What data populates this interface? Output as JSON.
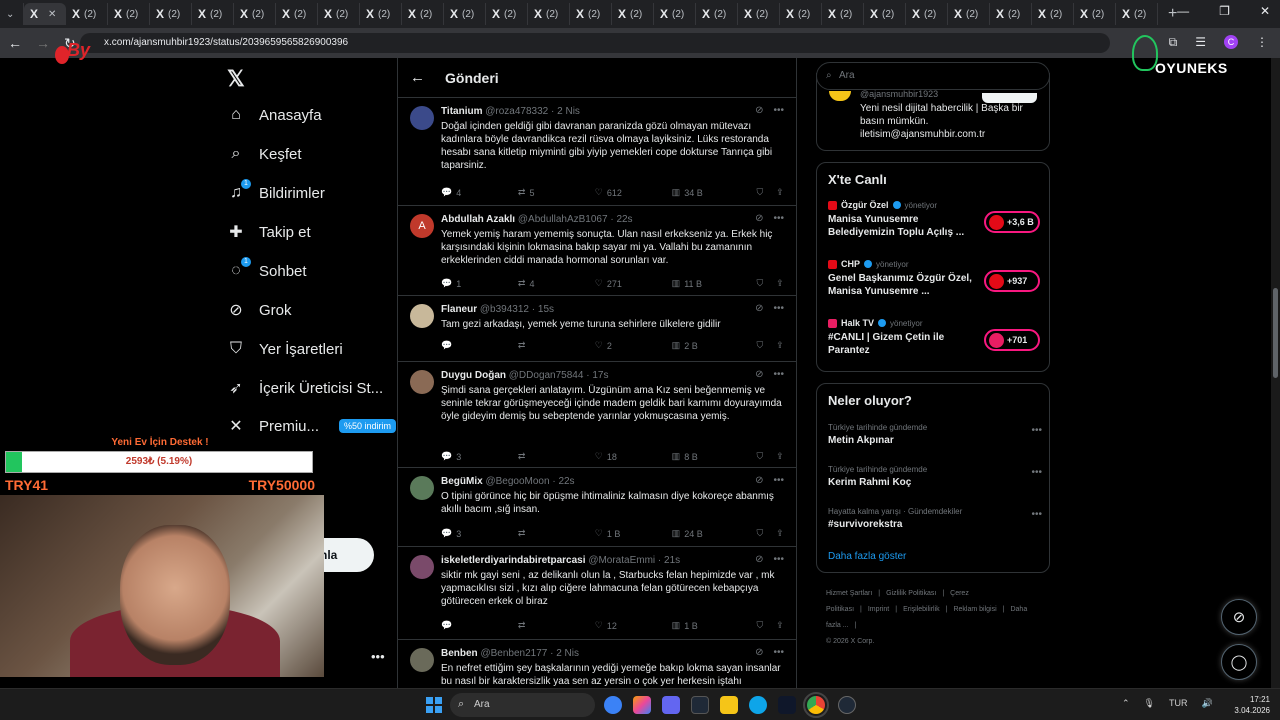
{
  "browser": {
    "active_tab_label": "X",
    "tab_label": "(2)",
    "tab_count": 26,
    "url": "x.com/ajansmuhbir1923/status/2039659565826900396",
    "profile_initial": "C"
  },
  "nav": {
    "items": [
      {
        "label": "Anasayfa",
        "icon": "home-icon"
      },
      {
        "label": "Keşfet",
        "icon": "search-icon"
      },
      {
        "label": "Bildirimler",
        "icon": "bell-icon",
        "dot": "1"
      },
      {
        "label": "Takip et",
        "icon": "add-person-icon"
      },
      {
        "label": "Sohbet",
        "icon": "chat-icon",
        "dot": "1"
      },
      {
        "label": "Grok",
        "icon": "grok-icon"
      },
      {
        "label": "Yer İşaretleri",
        "icon": "bookmark-icon"
      },
      {
        "label": "İçerik Üreticisi St...",
        "icon": "rocket-icon"
      },
      {
        "label": "Premiu...",
        "icon": "x-icon",
        "badge": "%50 indirim"
      }
    ],
    "post_button_partial": "nla"
  },
  "main": {
    "header_title": "Gönderi",
    "tweets": [
      {
        "name": "Titanium",
        "handle": "@roza478332",
        "time": "2 Nis",
        "text": "Doğal içinden geldiği gibi davranan paranizda gözü olmayan mütevazı kadınlara böyle davrandikca rezil rüsva olmaya layiksiniz. Lüks restoranda hesabı sana kitletip miyminti gibi yiyip yemekleri cope dokturse Tanrıça gibi taparsiniz.",
        "replies": "4",
        "reposts": "5",
        "likes": "612",
        "views": "34 B",
        "avatar_color": "#3b4a8a"
      },
      {
        "name": "Abdullah Azaklı",
        "handle": "@AbdullahAzB1067",
        "time": "22s",
        "text": "Yemek yemiş haram yememiş sonuçta. Ulan nasıl erkekseniz ya. Erkek hiç karşısındaki kişinin lokmasina bakıp sayar mi ya. Vallahi bu zamanının erkeklerinden ciddi manada hormonal sorunları var.",
        "replies": "1",
        "reposts": "4",
        "likes": "271",
        "views": "11 B",
        "avatar_color": "#c0392b",
        "avatar_letter": "A"
      },
      {
        "name": "Flaneur",
        "handle": "@b394312",
        "time": "15s",
        "text": "Tam gezi arkadaşı, yemek yeme turuna sehirlere ülkelere gidilir",
        "replies": "",
        "reposts": "",
        "likes": "2",
        "views": "2 B",
        "avatar_color": "#c8b89a"
      },
      {
        "name": "Duygu Doğan",
        "handle": "@DDogan75844",
        "time": "17s",
        "text": "Şimdi sana gerçekleri anlatayım. Üzgünüm ama Kız seni beğenmemiş ve seninle tekrar görüşmeyeceği içinde madem geldik bari karnımı doyurayımda öyle gideyim demiş bu sebeptende yarınlar yokmuşcasına yemiş.",
        "replies": "3",
        "reposts": "",
        "likes": "18",
        "views": "8 B",
        "avatar_color": "#8a6a55"
      },
      {
        "name": "BegüMix",
        "handle": "@BegooMoon",
        "time": "22s",
        "text": "O tipini görünce hiç bir öpüşme ihtimaliniz kalmasın diye kokoreçe abanmış akıllı bacım ,sığ insan.",
        "replies": "3",
        "reposts": "",
        "likes": "1 B",
        "views": "24 B",
        "avatar_color": "#5a7a5a"
      },
      {
        "name": "iskeletlerdiyarindabiretparcasi",
        "handle": "@MorataEmmi",
        "time": "21s",
        "text": "siktir mk gayi seni , az delikanlı olun la , Starbucks felan hepimizde var , mk yapmacıklısı sizi , kızı alıp ciğere lahmacuna felan götürecen kebapçıya götürecen erkek ol biraz",
        "replies": "",
        "reposts": "",
        "likes": "12",
        "views": "1 B",
        "avatar_color": "#7a4a6a"
      },
      {
        "name": "Benben",
        "handle": "@Benben2177",
        "time": "2 Nis",
        "text": "En nefret ettiğim şey başkalarının yediği yemeğe bakıp lokma sayan insanlar bu nasıl bir karaktersizlik yaa sen az yersin o çok yer herkesin iştahı",
        "replies": "",
        "reposts": "",
        "likes": "",
        "views": "",
        "avatar_color": "#6a6a5a"
      }
    ]
  },
  "right": {
    "search_placeholder": "Ara",
    "profile_handle_partial": "@ajansmuhbir1923",
    "profile_bio": "Yeni nesil dijital habercilik | Başka bir basın mümkün. iletisim@ajansmuhbir.com.tr",
    "live": {
      "title": "X'te Canlı",
      "items": [
        {
          "source": "Özgür Özel",
          "meta": "yönetiyor",
          "title": "Manisa Yunusemre Belediyemizin Toplu Açılış ...",
          "count": "+3,6 B",
          "src_color": "#e30a17"
        },
        {
          "source": "CHP",
          "meta": "yönetiyor",
          "title": "Genel Başkanımız Özgür Özel, Manisa Yunusemre ...",
          "count": "+937",
          "src_color": "#e30a17"
        },
        {
          "source": "Halk TV",
          "meta": "yönetiyor",
          "title": "#CANLI | Gizem Çetin ile Parantez",
          "count": "+701",
          "src_color": "#e91e63"
        }
      ]
    },
    "trends": {
      "title": "Neler oluyor?",
      "items": [
        {
          "category": "Türkiye tarihinde gündemde",
          "name": "Metin Akpınar"
        },
        {
          "category": "Türkiye tarihinde gündemde",
          "name": "Kerim Rahmi Koç"
        },
        {
          "category": "Hayatta kalma yarışı · Gündemdekiler",
          "name": "#survivorekstra"
        }
      ],
      "show_more": "Daha fazla göster"
    },
    "footer": {
      "links": [
        "Hizmet Şartları",
        "|",
        "Gizlilik Politikası",
        "|",
        "Çerez Politikası",
        "|",
        "Imprint",
        "|",
        "Erişilebilirlik",
        "|",
        "Reklam bilgisi",
        "|",
        "Daha fazla ...",
        "|"
      ],
      "copyright": "© 2026 X Corp."
    }
  },
  "overlay": {
    "donation_title": "Yeni Ev İçin Destek !",
    "donation_amount": "2593₺ (5.19%)",
    "donation_progress": 0.0519,
    "donation_min": "TRY41",
    "donation_max": "TRY50000",
    "stream_logo": "By",
    "brand_name": "OYUNEKS"
  },
  "taskbar": {
    "search_label": "Ara",
    "language": "TUR",
    "time": "17:21",
    "date": "3.04.2026"
  }
}
